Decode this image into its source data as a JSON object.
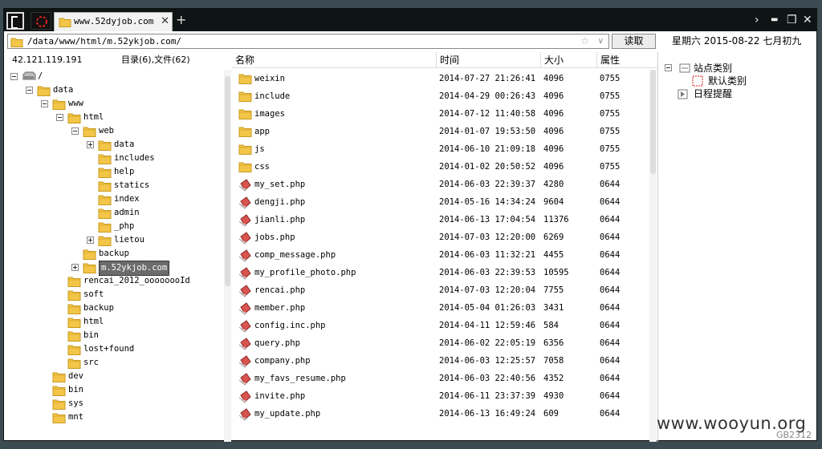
{
  "tab": {
    "title": "www.52dyjob.com",
    "close": "✕",
    "new_tab": "+"
  },
  "window_controls": {
    "menu": "›",
    "minimize": "▬",
    "maximize": "❐",
    "close": "✕"
  },
  "address": {
    "path": "/data/www/html/m.52ykjob.com/",
    "star": "☆",
    "dropdown": "∨"
  },
  "read_button": "读取",
  "date_text": "星期六 2015-08-22 七月初九",
  "left": {
    "ip": "42.121.119.191",
    "counts": "目录(6),文件(62)"
  },
  "tree": [
    {
      "label": "/",
      "depth": 0,
      "toggle": "minus",
      "icon": "drive-icon"
    },
    {
      "label": "data",
      "depth": 1,
      "toggle": "minus"
    },
    {
      "label": "www",
      "depth": 2,
      "toggle": "minus"
    },
    {
      "label": "html",
      "depth": 3,
      "toggle": "minus"
    },
    {
      "label": "web",
      "depth": 4,
      "toggle": "minus"
    },
    {
      "label": "data",
      "depth": 5,
      "toggle": "plus"
    },
    {
      "label": "includes",
      "depth": 5,
      "toggle": "none"
    },
    {
      "label": "help",
      "depth": 5,
      "toggle": "none"
    },
    {
      "label": "statics",
      "depth": 5,
      "toggle": "none"
    },
    {
      "label": "index",
      "depth": 5,
      "toggle": "none"
    },
    {
      "label": "admin",
      "depth": 5,
      "toggle": "none"
    },
    {
      "label": "_php",
      "depth": 5,
      "toggle": "none"
    },
    {
      "label": "lietou",
      "depth": 5,
      "toggle": "plus"
    },
    {
      "label": "backup",
      "depth": 4,
      "toggle": "none"
    },
    {
      "label": "m.52ykjob.com",
      "depth": 4,
      "toggle": "plus",
      "selected": true
    },
    {
      "label": "rencai_2012_oooooooId",
      "depth": 3,
      "toggle": "none"
    },
    {
      "label": "soft",
      "depth": 3,
      "toggle": "none"
    },
    {
      "label": "backup",
      "depth": 3,
      "toggle": "none"
    },
    {
      "label": "html",
      "depth": 3,
      "toggle": "none"
    },
    {
      "label": "bin",
      "depth": 3,
      "toggle": "none"
    },
    {
      "label": "lost+found",
      "depth": 3,
      "toggle": "none"
    },
    {
      "label": "src",
      "depth": 3,
      "toggle": "none"
    },
    {
      "label": "dev",
      "depth": 2,
      "toggle": "none"
    },
    {
      "label": "bin",
      "depth": 2,
      "toggle": "none"
    },
    {
      "label": "sys",
      "depth": 2,
      "toggle": "none"
    },
    {
      "label": "mnt",
      "depth": 2,
      "toggle": "none"
    }
  ],
  "columns": {
    "name": "名称",
    "time": "时间",
    "size": "大小",
    "perm": "属性"
  },
  "files": [
    {
      "name": "weixin",
      "time": "2014-07-27 21:26:41",
      "size": "4096",
      "perm": "0755",
      "type": "folder"
    },
    {
      "name": "include",
      "time": "2014-04-29 00:26:43",
      "size": "4096",
      "perm": "0755",
      "type": "folder"
    },
    {
      "name": "images",
      "time": "2014-07-12 11:40:58",
      "size": "4096",
      "perm": "0755",
      "type": "folder"
    },
    {
      "name": "app",
      "time": "2014-01-07 19:53:50",
      "size": "4096",
      "perm": "0755",
      "type": "folder"
    },
    {
      "name": "js",
      "time": "2014-06-10 21:09:18",
      "size": "4096",
      "perm": "0755",
      "type": "folder"
    },
    {
      "name": "css",
      "time": "2014-01-02 20:50:52",
      "size": "4096",
      "perm": "0755",
      "type": "folder"
    },
    {
      "name": "my_set.php",
      "time": "2014-06-03 22:39:37",
      "size": "4280",
      "perm": "0644",
      "type": "php"
    },
    {
      "name": "dengji.php",
      "time": "2014-05-16 14:34:24",
      "size": "9604",
      "perm": "0644",
      "type": "php"
    },
    {
      "name": "jianli.php",
      "time": "2014-06-13 17:04:54",
      "size": "11376",
      "perm": "0644",
      "type": "php"
    },
    {
      "name": "jobs.php",
      "time": "2014-07-03 12:20:00",
      "size": "6269",
      "perm": "0644",
      "type": "php"
    },
    {
      "name": "comp_message.php",
      "time": "2014-06-03 11:32:21",
      "size": "4455",
      "perm": "0644",
      "type": "php"
    },
    {
      "name": "my_profile_photo.php",
      "time": "2014-06-03 22:39:53",
      "size": "10595",
      "perm": "0644",
      "type": "php"
    },
    {
      "name": "rencai.php",
      "time": "2014-07-03 12:20:04",
      "size": "7755",
      "perm": "0644",
      "type": "php"
    },
    {
      "name": "member.php",
      "time": "2014-05-04 01:26:03",
      "size": "3431",
      "perm": "0644",
      "type": "php"
    },
    {
      "name": "config.inc.php",
      "time": "2014-04-11 12:59:46",
      "size": "584",
      "perm": "0644",
      "type": "php"
    },
    {
      "name": "query.php",
      "time": "2014-06-02 22:05:19",
      "size": "6356",
      "perm": "0644",
      "type": "php"
    },
    {
      "name": "company.php",
      "time": "2014-06-03 12:25:57",
      "size": "7058",
      "perm": "0644",
      "type": "php"
    },
    {
      "name": "my_favs_resume.php",
      "time": "2014-06-03 22:40:56",
      "size": "4352",
      "perm": "0644",
      "type": "php"
    },
    {
      "name": "invite.php",
      "time": "2014-06-11 23:37:39",
      "size": "4930",
      "perm": "0644",
      "type": "php"
    },
    {
      "name": "my_update.php",
      "time": "2014-06-13 16:49:24",
      "size": "609",
      "perm": "0644",
      "type": "php"
    }
  ],
  "side": {
    "root": "站点类别",
    "child": "默认类别",
    "reminder": "日程提醒"
  },
  "watermark": "www.wooyun.org",
  "watermark_code": "GB2312",
  "colors": {
    "folder": "#f3c64a",
    "folder_edge": "#c99a1c",
    "php": "#d9534f",
    "selection": "#6b6b6b"
  }
}
